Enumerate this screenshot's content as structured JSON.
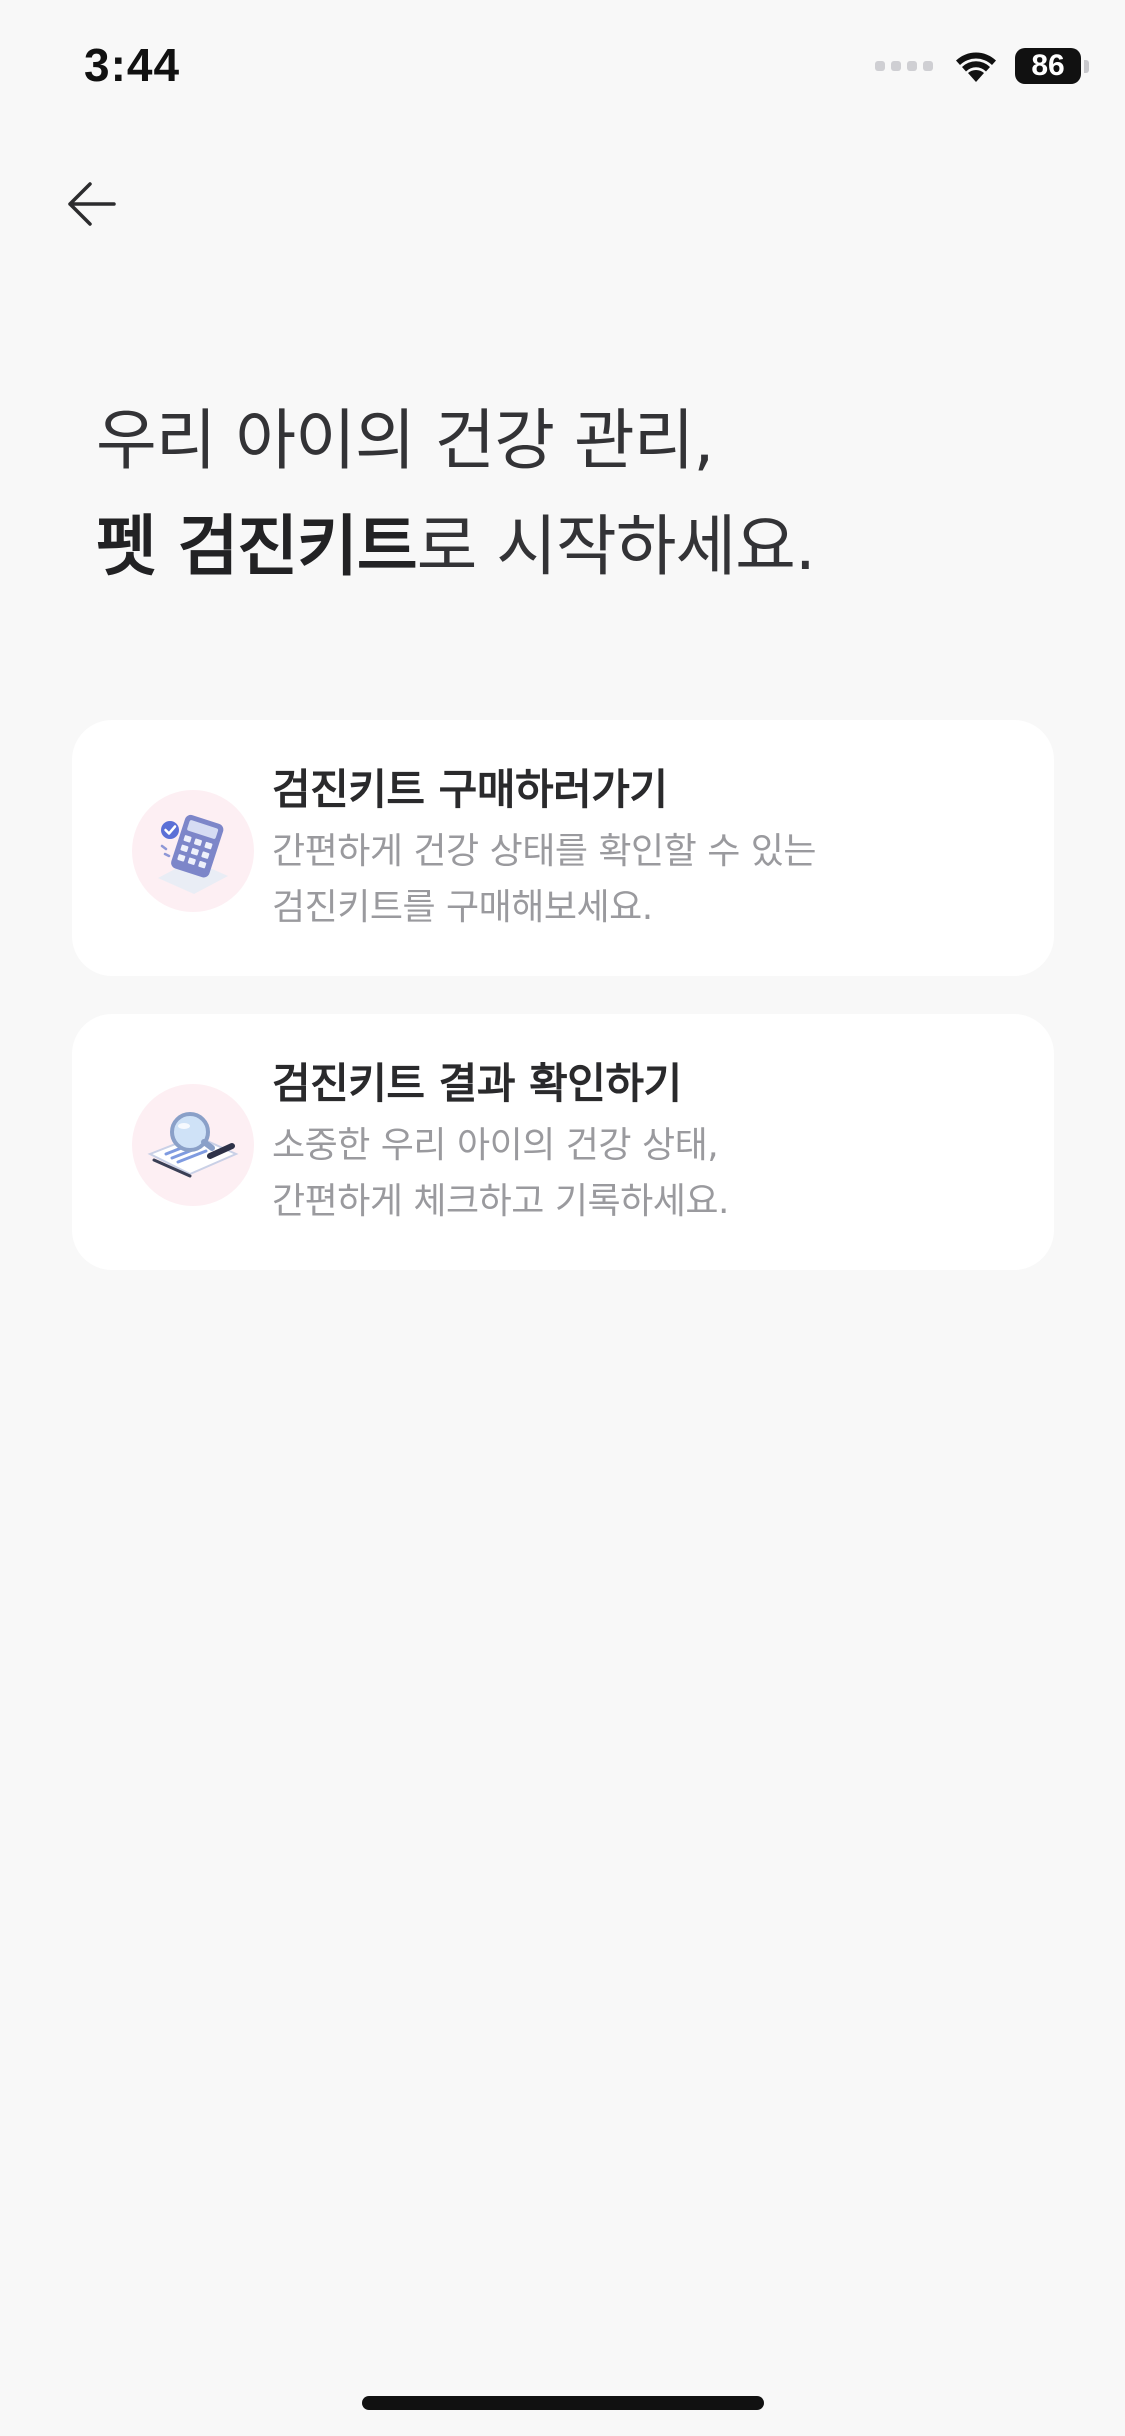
{
  "status_bar": {
    "time": "3:44",
    "battery": "86",
    "icons": [
      "signal-dots-icon",
      "wifi-icon",
      "battery-icon"
    ]
  },
  "header": {
    "back_icon": "arrow-left-icon"
  },
  "headline": {
    "line1": "우리 아이의 건강 관리,",
    "line2_bold": "펫 검진키트",
    "line2_rest": "로 시작하세요."
  },
  "cards": [
    {
      "title": "검진키트 구매하러가기",
      "desc_line1": "간편하게 건강 상태를 확인할 수 있는",
      "desc_line2": "검진키트를 구매해보세요.",
      "icon": "calculator-check-icon"
    },
    {
      "title": "검진키트 결과 확인하기",
      "desc_line1": "소중한 우리 아이의 건강 상태,",
      "desc_line2": "간편하게 체크하고 기록하세요.",
      "icon": "magnifier-report-icon"
    }
  ],
  "colors": {
    "background": "#f8f8f8",
    "card": "#ffffff",
    "icon_circle": "#fdeff3",
    "title_text": "#2a2a2c",
    "desc_text": "#9a9a9e"
  }
}
